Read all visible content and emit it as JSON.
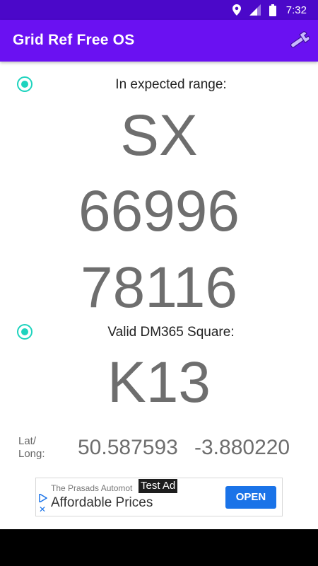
{
  "status_bar": {
    "time": "7:32",
    "icons": [
      "location-icon",
      "signal-icon",
      "battery-icon"
    ]
  },
  "app_bar": {
    "title": "Grid Ref Free OS",
    "settings_icon": "wrench-icon"
  },
  "range_section": {
    "label": "In expected range:",
    "grid_letters": "SX",
    "easting": "66996",
    "northing": "78116"
  },
  "dm365_section": {
    "label": "Valid DM365 Square:",
    "square": "K13"
  },
  "latlong": {
    "label_line1": "Lat/",
    "label_line2": "Long:",
    "latitude": "50.587593",
    "longitude": "-3.880220"
  },
  "ad": {
    "badge": "Test Ad",
    "source": "The Prasads Automot",
    "headline": "Affordable Prices",
    "button": "OPEN",
    "close_glyph": "✕"
  },
  "colors": {
    "status_bar": "#4b08c9",
    "app_bar": "#6a11f2",
    "radio_accent": "#1ed3be",
    "big_text": "#6e6e6e",
    "ad_button": "#1a73e8"
  }
}
